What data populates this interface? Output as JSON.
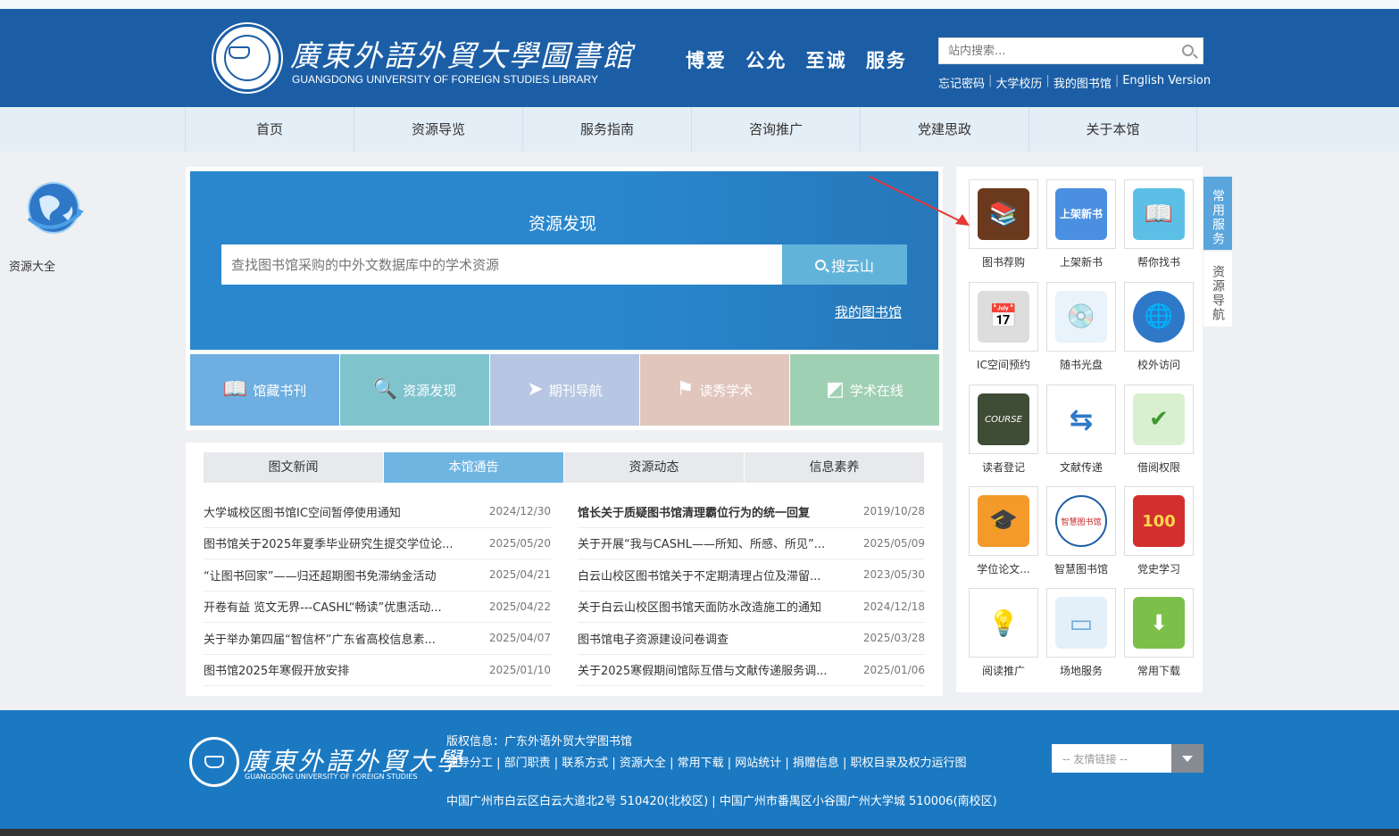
{
  "header": {
    "logo_cn": "廣東外語外貿大學圖書館",
    "logo_en": "GUANGDONG UNIVERSITY OF FOREIGN STUDIES LIBRARY",
    "motto": "博爱  公允  至诚  服务",
    "search_placeholder": "站内搜索...",
    "links": [
      "忘记密码",
      "大学校历",
      "我的图书馆",
      "English Version"
    ]
  },
  "nav": [
    "首页",
    "资源导览",
    "服务指南",
    "咨询推广",
    "党建思政",
    "关于本馆"
  ],
  "left_float": {
    "label": "资源大全"
  },
  "discovery": {
    "title": "资源发现",
    "placeholder": "查找图书馆采购的中外文数据库中的学术资源",
    "button": "搜云山",
    "my_library": "我的图书馆",
    "tiles": [
      {
        "label": "馆藏书刊",
        "color": "#6eaee0"
      },
      {
        "label": "资源发现",
        "color": "#7fc3cd"
      },
      {
        "label": "期刊导航",
        "color": "#b7c6e2"
      },
      {
        "label": "读秀学术",
        "color": "#e1c6bd"
      },
      {
        "label": "学术在线",
        "color": "#9fd0b3"
      }
    ]
  },
  "news": {
    "tabs": [
      "图文新闻",
      "本馆通告",
      "资源动态",
      "信息素养"
    ],
    "active_tab": "本馆通告",
    "left": [
      {
        "title": "大学城校区图书馆IC空间暂停使用通知",
        "date": "2024/12/30"
      },
      {
        "title": "图书馆关于2025年夏季毕业研究生提交学位论...",
        "date": "2025/05/20"
      },
      {
        "title": "“让图书回家”——归还超期图书免滞纳金活动",
        "date": "2025/04/21"
      },
      {
        "title": "开卷有益 览文无界---CASHL“畅读”优惠活动...",
        "date": "2025/04/22"
      },
      {
        "title": "关于举办第四届“智信杯”广东省高校信息素...",
        "date": "2025/04/07"
      },
      {
        "title": "图书馆2025年寒假开放安排",
        "date": "2025/01/10"
      }
    ],
    "right": [
      {
        "title": "馆长关于质疑图书馆清理霸位行为的统一回复",
        "date": "2019/10/28",
        "bold": true
      },
      {
        "title": "关于开展“我与CASHL——所知、所感、所见”...",
        "date": "2025/05/09"
      },
      {
        "title": "白云山校区图书馆关于不定期清理占位及滞留...",
        "date": "2023/05/30"
      },
      {
        "title": "关于白云山校区图书馆天面防水改造施工的通知",
        "date": "2024/12/18"
      },
      {
        "title": "图书馆电子资源建设问卷调查",
        "date": "2025/03/28"
      },
      {
        "title": "关于2025寒假期间馆际互借与文献传递服务调...",
        "date": "2025/01/06"
      }
    ]
  },
  "services": {
    "items": [
      {
        "label": "图书荐购",
        "icon": "bookshelf-icon",
        "glyph": "📚"
      },
      {
        "label": "上架新书",
        "icon": "new-books-icon",
        "glyph": "上架新书"
      },
      {
        "label": "帮你找书",
        "icon": "open-book-icon",
        "glyph": "📖"
      },
      {
        "label": "IC空间预约",
        "icon": "calendar-icon",
        "glyph": "📅"
      },
      {
        "label": "随书光盘",
        "icon": "cd-music-icon",
        "glyph": "💿"
      },
      {
        "label": "校外访问",
        "icon": "globe-icon",
        "glyph": "🌐"
      },
      {
        "label": "读者登记",
        "icon": "chalkboard-icon",
        "glyph": "COURSE"
      },
      {
        "label": "文献传递",
        "icon": "exchange-arrows-icon",
        "glyph": "⇆"
      },
      {
        "label": "借阅权限",
        "icon": "shield-check-icon",
        "glyph": "✔"
      },
      {
        "label": "学位论文...",
        "icon": "graduation-cap-icon",
        "glyph": "🎓"
      },
      {
        "label": "智慧图书馆",
        "icon": "smart-library-logo-icon",
        "glyph": "智慧图书馆"
      },
      {
        "label": "党史学习",
        "icon": "party-history-icon",
        "glyph": "100"
      },
      {
        "label": "阅读推广",
        "icon": "lightbulb-icon",
        "glyph": "💡"
      },
      {
        "label": "场地服务",
        "icon": "projector-screen-icon",
        "glyph": "▭"
      },
      {
        "label": "常用下载",
        "icon": "download-icon",
        "glyph": "⬇"
      }
    ],
    "side_tabs": [
      "常用服务",
      "资源导航"
    ]
  },
  "footer": {
    "logo_cn": "廣東外語外貿大學",
    "logo_en": "GUANGDONG UNIVERSITY OF FOREIGN STUDIES",
    "copyright": "版权信息：广东外语外贸大学图书馆",
    "links": "领导分工 | 部门职责 | 联系方式 | 资源大全 | 常用下载 | 网站统计 | 捐赠信息 | 职权目录及权力运行图",
    "address": "中国广州市白云区白云大道北2号 510420(北校区) | 中国广州市番禺区小谷围广州大学城 510006(南校区)",
    "select_placeholder": "-- 友情链接 --"
  },
  "colors": {
    "header": "#1b5ea6",
    "footer": "#1b79c2",
    "accent": "#2a87cd"
  }
}
